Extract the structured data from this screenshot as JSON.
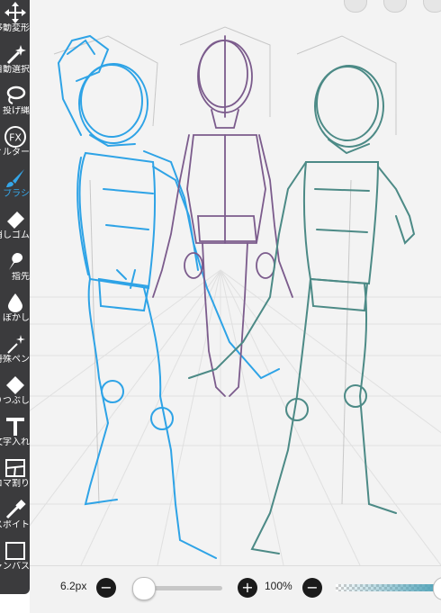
{
  "toolbar": {
    "tools": [
      {
        "name": "transform",
        "label": "移動変形",
        "icon": "move-arrows-icon",
        "active": false
      },
      {
        "name": "magic-wand",
        "label": "自動選択",
        "icon": "magic-wand-icon",
        "active": false
      },
      {
        "name": "lasso",
        "label": "投げ縄",
        "icon": "lasso-icon",
        "active": false
      },
      {
        "name": "filter",
        "label": "フィルター",
        "icon": "fx-icon",
        "active": false
      },
      {
        "name": "brush",
        "label": "ブラシ",
        "icon": "brush-icon",
        "active": true
      },
      {
        "name": "eraser",
        "label": "消しゴム",
        "icon": "eraser-icon",
        "active": false
      },
      {
        "name": "smudge",
        "label": "指先",
        "icon": "smudge-icon",
        "active": false
      },
      {
        "name": "blur",
        "label": "ぼかし",
        "icon": "blur-drop-icon",
        "active": false
      },
      {
        "name": "special-pen",
        "label": "特殊ペン",
        "icon": "sparkle-pen-icon",
        "active": false
      },
      {
        "name": "fill",
        "label": "塗りつぶし",
        "icon": "bucket-icon",
        "active": false
      },
      {
        "name": "text",
        "label": "文字入れ",
        "icon": "text-t-icon",
        "active": false
      },
      {
        "name": "frame-divider",
        "label": "コマ割り",
        "icon": "frame-divider-icon",
        "active": false
      },
      {
        "name": "eyedropper",
        "label": "スポイト",
        "icon": "eyedropper-icon",
        "active": false
      },
      {
        "name": "canvas",
        "label": "キャンバス",
        "icon": "canvas-icon",
        "active": false
      }
    ]
  },
  "bottombar": {
    "brush_size": "6.2px",
    "brush_size_fraction": 0.12,
    "minus_label": "−",
    "plus_label": "+",
    "opacity": "100%",
    "opacity_fraction": 1.0,
    "opacity_color": "#4ea2b8"
  },
  "colors": {
    "toolbar_bg": "#3b3b3d",
    "active_tool": "#35a7ea",
    "figure_left": "#2ea3e6",
    "figure_center": "#7b5b8c",
    "figure_right": "#4c8a86"
  }
}
